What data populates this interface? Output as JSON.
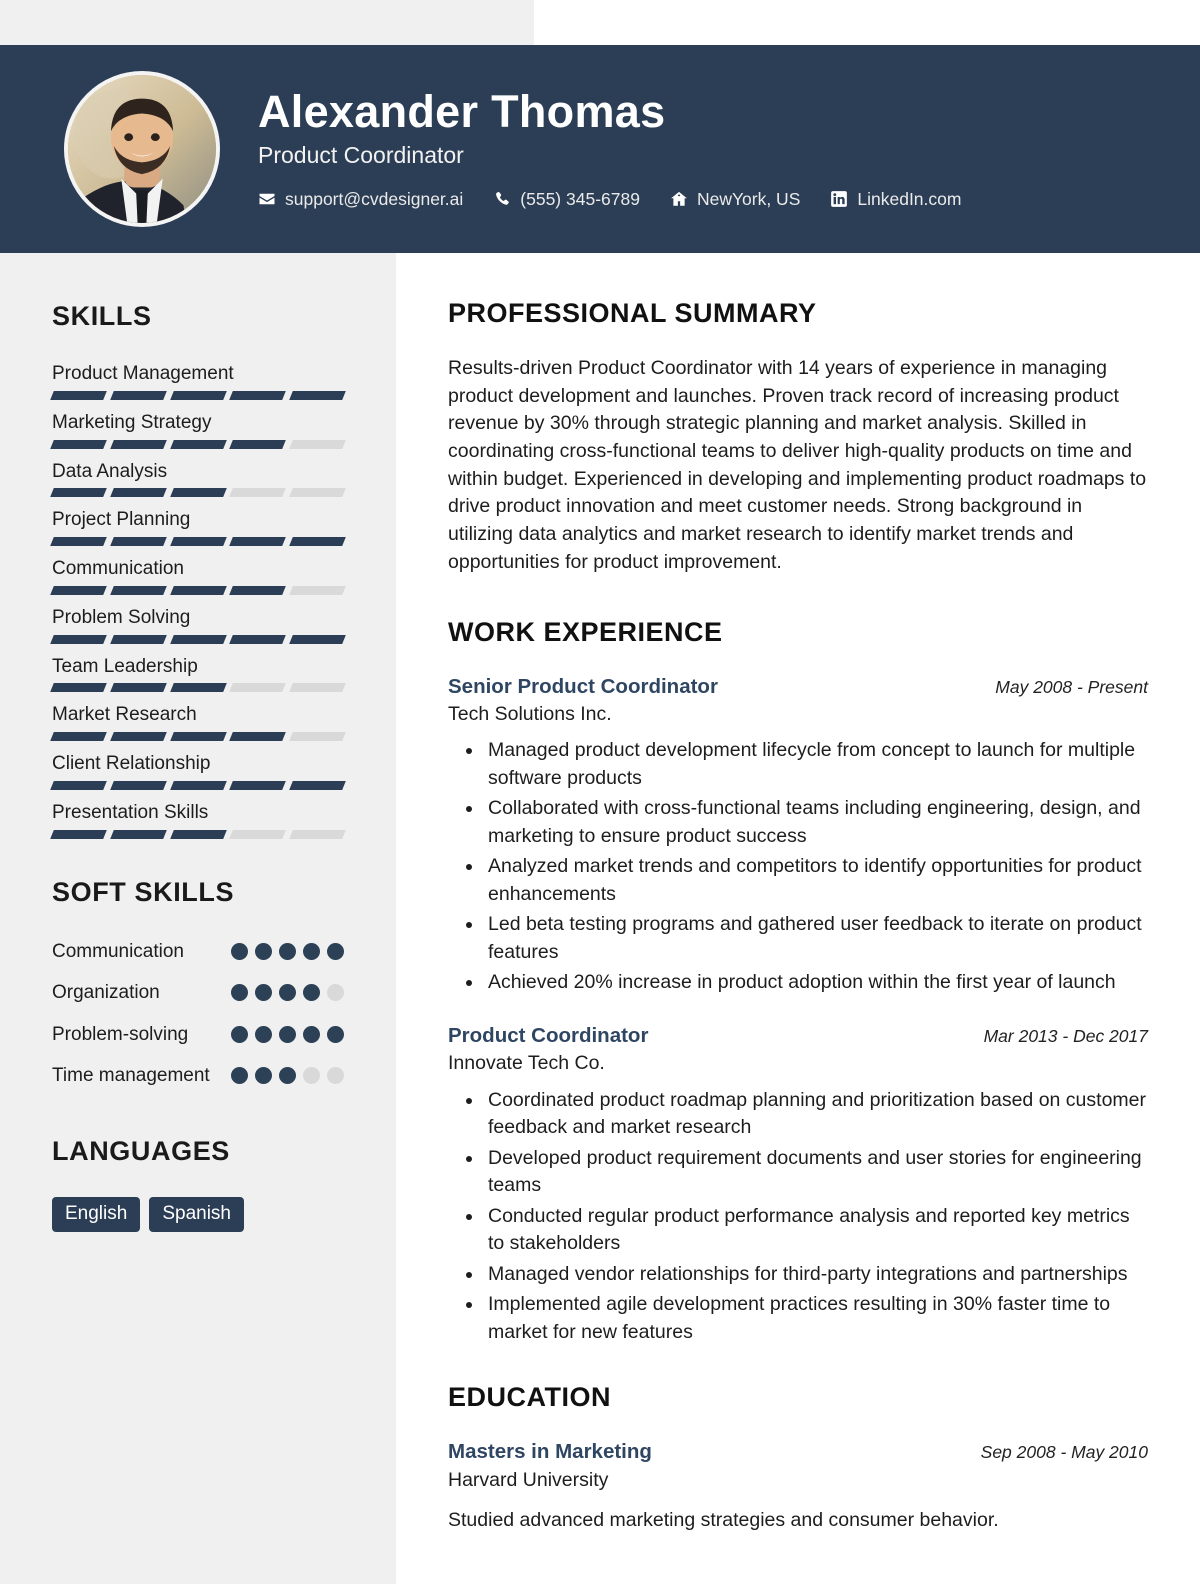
{
  "theme": {
    "navy": "#2c3e55",
    "sidebar_bg": "#f0f0f0",
    "title_blue": "#2f4663",
    "muted_seg": "#d9d9d9"
  },
  "header": {
    "name": "Alexander Thomas",
    "job_title": "Product Coordinator",
    "contacts": [
      {
        "icon": "envelope-icon",
        "text": "support@cvdesigner.ai"
      },
      {
        "icon": "phone-icon",
        "text": "(555) 345-6789"
      },
      {
        "icon": "home-icon",
        "text": "NewYork, US"
      },
      {
        "icon": "linkedin-icon",
        "text": "LinkedIn.com"
      }
    ]
  },
  "sidebar": {
    "skills_heading": "SKILLS",
    "skills": [
      {
        "label": "Product Management",
        "level": 5,
        "max": 5
      },
      {
        "label": "Marketing Strategy",
        "level": 4,
        "max": 5
      },
      {
        "label": "Data Analysis",
        "level": 3,
        "max": 5
      },
      {
        "label": "Project Planning",
        "level": 5,
        "max": 5
      },
      {
        "label": "Communication",
        "level": 4,
        "max": 5
      },
      {
        "label": "Problem Solving",
        "level": 5,
        "max": 5
      },
      {
        "label": "Team Leadership",
        "level": 3,
        "max": 5
      },
      {
        "label": "Market Research",
        "level": 4,
        "max": 5
      },
      {
        "label": "Client Relationship",
        "level": 5,
        "max": 5
      },
      {
        "label": "Presentation Skills",
        "level": 3,
        "max": 5
      }
    ],
    "soft_skills_heading": "SOFT SKILLS",
    "soft_skills": [
      {
        "label": "Communication",
        "rating": 5,
        "max": 5
      },
      {
        "label": "Organization",
        "rating": 4,
        "max": 5
      },
      {
        "label": "Problem-solving",
        "rating": 5,
        "max": 5
      },
      {
        "label": "Time management",
        "rating": 3,
        "max": 5
      }
    ],
    "languages_heading": "LANGUAGES",
    "languages": [
      "English",
      "Spanish"
    ]
  },
  "main": {
    "summary_heading": "PROFESSIONAL SUMMARY",
    "summary_text": "Results-driven Product Coordinator with 14 years of experience in managing product development and launches. Proven track record of increasing product revenue by 30% through strategic planning and market analysis. Skilled in coordinating cross-functional teams to deliver high-quality products on time and within budget. Experienced in developing and implementing product roadmaps to drive product innovation and meet customer needs. Strong background in utilizing data analytics and market research to identify market trends and opportunities for product improvement.",
    "experience_heading": "WORK EXPERIENCE",
    "experience": [
      {
        "title": "Senior Product Coordinator",
        "date": "May 2008 - Present",
        "company": "Tech Solutions Inc.",
        "bullets": [
          "Managed product development lifecycle from concept to launch for multiple software products",
          "Collaborated with cross-functional teams including engineering, design, and marketing to ensure product success",
          "Analyzed market trends and competitors to identify opportunities for product enhancements",
          "Led beta testing programs and gathered user feedback to iterate on product features",
          "Achieved 20% increase in product adoption within the first year of launch"
        ]
      },
      {
        "title": "Product Coordinator",
        "date": "Mar 2013 - Dec 2017",
        "company": "Innovate Tech Co.",
        "bullets": [
          "Coordinated product roadmap planning and prioritization based on customer feedback and market research",
          "Developed product requirement documents and user stories for engineering teams",
          "Conducted regular product performance analysis and reported key metrics to stakeholders",
          "Managed vendor relationships for third-party integrations and partnerships",
          "Implemented agile development practices resulting in 30% faster time to market for new features"
        ]
      }
    ],
    "education_heading": "EDUCATION",
    "education": [
      {
        "degree": "Masters in Marketing",
        "date": "Sep 2008 - May 2010",
        "school": "Harvard University",
        "description": "Studied advanced marketing strategies and consumer behavior."
      }
    ]
  }
}
